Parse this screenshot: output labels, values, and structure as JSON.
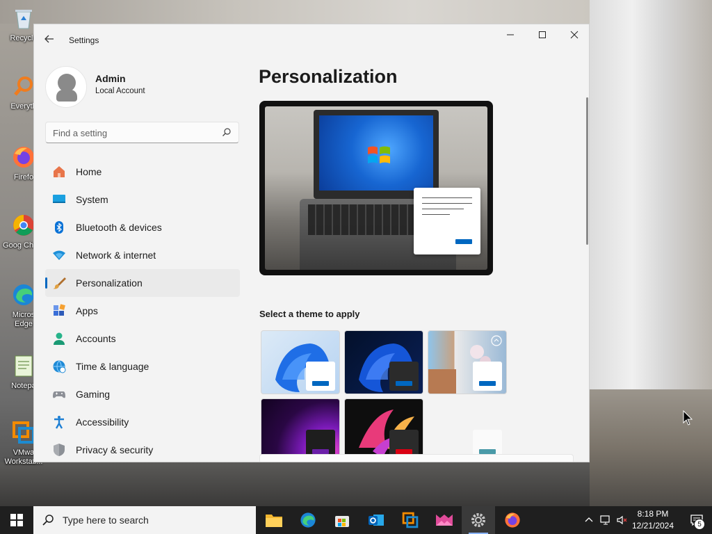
{
  "desktop": {
    "icons": [
      {
        "label": "Recycle",
        "icon": "recycle-bin-icon"
      },
      {
        "label": "Everyth",
        "icon": "everything-search-icon"
      },
      {
        "label": "Firefo",
        "icon": "firefox-icon"
      },
      {
        "label": "Goog Chron",
        "icon": "chrome-icon"
      },
      {
        "label": "Micros Edge",
        "icon": "edge-icon"
      },
      {
        "label": "Notepa",
        "icon": "notepad-icon"
      },
      {
        "label": "VMwa Workstati...",
        "icon": "vmware-icon"
      }
    ]
  },
  "window": {
    "app_title": "Settings",
    "user": {
      "name": "Admin",
      "type": "Local Account"
    },
    "search": {
      "placeholder": "Find a setting"
    },
    "nav": [
      {
        "label": "Home",
        "icon": "home-icon"
      },
      {
        "label": "System",
        "icon": "system-icon"
      },
      {
        "label": "Bluetooth & devices",
        "icon": "bluetooth-icon"
      },
      {
        "label": "Network & internet",
        "icon": "network-icon"
      },
      {
        "label": "Personalization",
        "icon": "paintbrush-icon",
        "active": true
      },
      {
        "label": "Apps",
        "icon": "apps-icon"
      },
      {
        "label": "Accounts",
        "icon": "accounts-icon"
      },
      {
        "label": "Time & language",
        "icon": "globe-clock-icon"
      },
      {
        "label": "Gaming",
        "icon": "gamepad-icon"
      },
      {
        "label": "Accessibility",
        "icon": "accessibility-icon"
      },
      {
        "label": "Privacy & security",
        "icon": "shield-icon"
      }
    ],
    "page_title": "Personalization",
    "section_label": "Select a theme to apply",
    "themes": [
      {
        "name": "windows-light",
        "accent": "#0067c0"
      },
      {
        "name": "windows-dark",
        "accent": "#0067c0"
      },
      {
        "name": "captured-motion",
        "accent": "#0067c0"
      },
      {
        "name": "glow",
        "accent": "#6a1fa8"
      },
      {
        "name": "flow",
        "accent": "#d90012"
      },
      {
        "name": "sunrise",
        "accent": "#4a9aa8"
      }
    ]
  },
  "taskbar": {
    "search_placeholder": "Type here to search",
    "apps": [
      "file-explorer-icon",
      "edge-icon",
      "store-icon",
      "outlook-icon",
      "vmware-icon",
      "media-app-icon",
      "settings-icon",
      "firefox-icon"
    ],
    "time": "8:18 PM",
    "date": "12/21/2024",
    "notification_count": "5"
  },
  "colors": {
    "accent": "#0067c0",
    "taskbar": "#1f1f1f",
    "window_bg": "#f3f3f3"
  }
}
